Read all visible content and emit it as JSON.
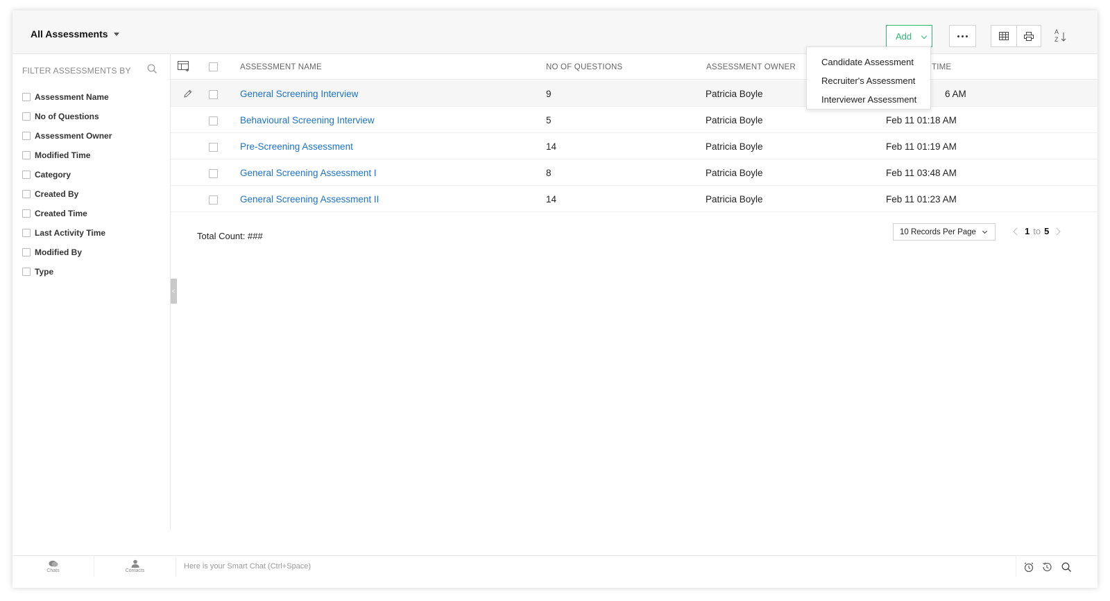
{
  "header": {
    "view_label": "All Assessments",
    "add_label": "Add"
  },
  "add_menu": {
    "items": [
      "Candidate Assessment",
      "Recruiter's Assessment",
      "Interviewer Assessment"
    ]
  },
  "sidebar": {
    "title": "FILTER ASSESSMENTS BY",
    "filters": [
      "Assessment Name",
      "No of Questions",
      "Assessment Owner",
      "Modified Time",
      "Category",
      "Created By",
      "Created Time",
      "Last Activity Time",
      "Modified By",
      "Type"
    ]
  },
  "table": {
    "columns": {
      "name": "ASSESSMENT NAME",
      "questions": "NO OF QUESTIONS",
      "owner": "ASSESSMENT OWNER",
      "time": "TIME"
    },
    "rows": [
      {
        "name": "General Screening Interview",
        "questions": "9",
        "owner": "Patricia Boyle",
        "time": "6 AM"
      },
      {
        "name": "Behavioural Screening Interview",
        "questions": "5",
        "owner": "Patricia Boyle",
        "time": "Feb 11 01:18 AM"
      },
      {
        "name": "Pre-Screening Assessment",
        "questions": "14",
        "owner": "Patricia Boyle",
        "time": "Feb 11 01:19 AM"
      },
      {
        "name": "General Screening Assessment I",
        "questions": "8",
        "owner": "Patricia Boyle",
        "time": "Feb 11 03:48 AM"
      },
      {
        "name": "General Screening Assessment II",
        "questions": "14",
        "owner": "Patricia Boyle",
        "time": "Feb 11 01:23 AM"
      }
    ]
  },
  "footer": {
    "total_label": "Total Count: ###",
    "per_page": "10 Records Per Page",
    "page_from": "1",
    "page_to_word": "to",
    "page_to": "5"
  },
  "bottombar": {
    "chats_label": "Chats",
    "contacts_label": "Contacts",
    "smartchat_placeholder": "Here is your Smart Chat (Ctrl+Space)"
  },
  "colors": {
    "accent_green": "#2bb673",
    "link_blue": "#1a73c8"
  }
}
